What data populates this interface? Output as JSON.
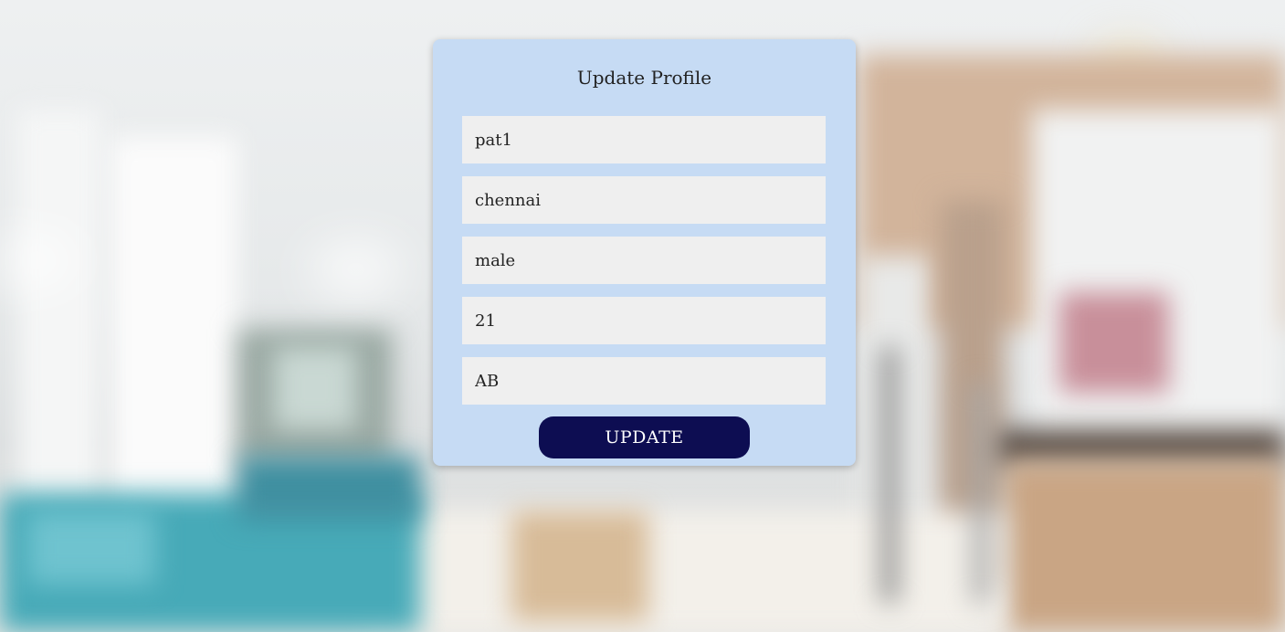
{
  "form": {
    "title": "Update Profile",
    "fields": [
      {
        "value": "pat1"
      },
      {
        "value": "chennai"
      },
      {
        "value": "male"
      },
      {
        "value": "21"
      },
      {
        "value": "AB"
      }
    ],
    "submit_label": "UPDATE"
  },
  "colors": {
    "card_background": "#c6dbf4",
    "field_background": "#efefef",
    "button_background": "#0d0d52",
    "button_text": "#ffffff"
  }
}
